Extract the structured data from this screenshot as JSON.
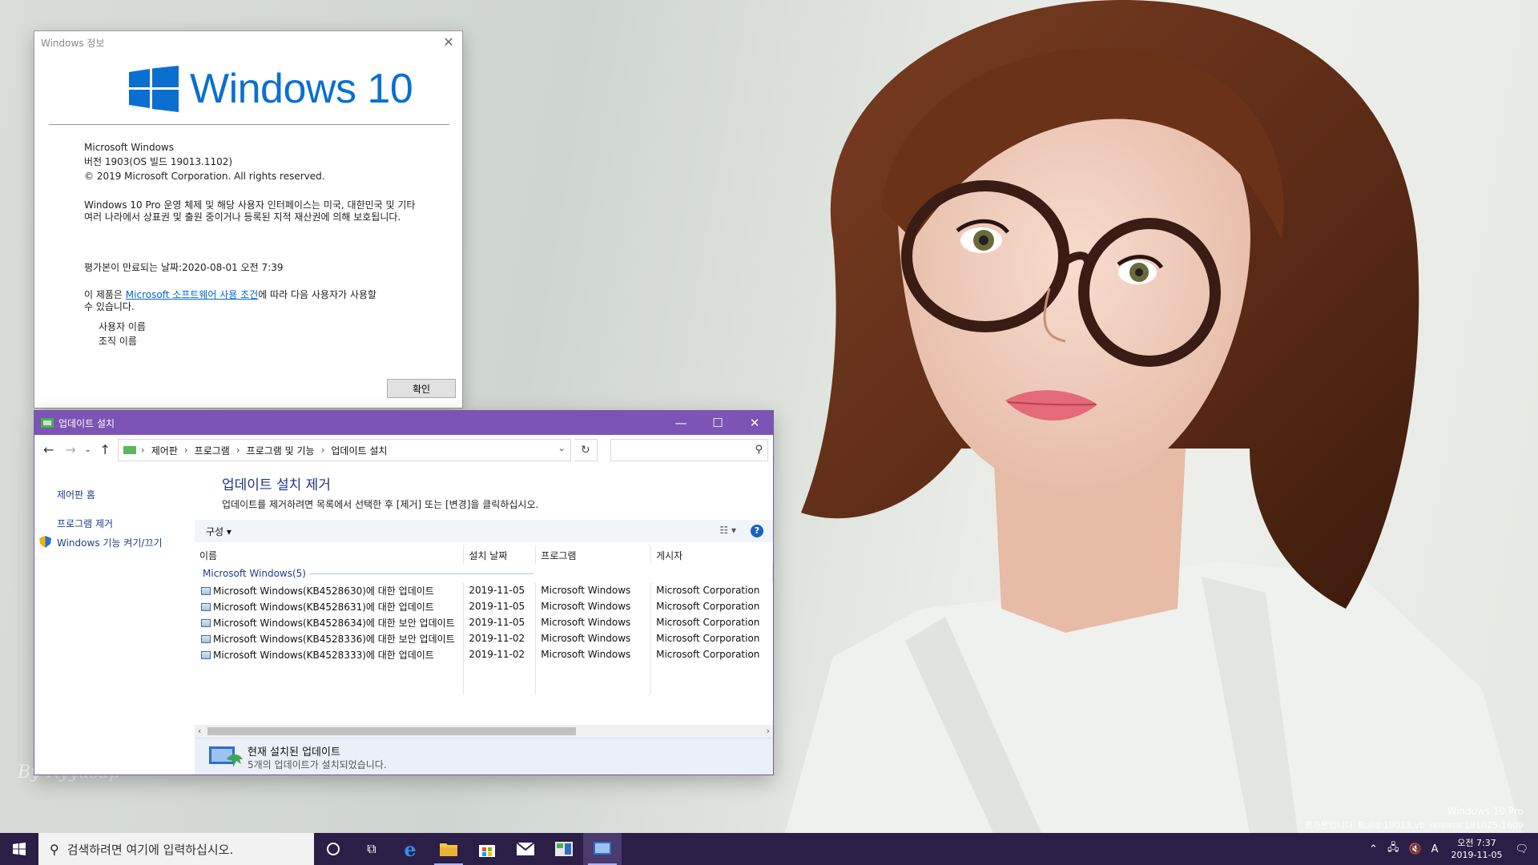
{
  "desktop": {
    "watermark_by": "By Ryyasap",
    "watermark_edition": "Windows 10 Pro",
    "watermark_build": "평가본입니다. Build 19013.vb_release.191025-1609"
  },
  "about": {
    "title": "Windows 정보",
    "logo_text": "Windows 10",
    "line1": "Microsoft Windows",
    "line2": "버전 1903(OS 빌드 19013.1102)",
    "line3": "© 2019 Microsoft Corporation. All rights reserved.",
    "para1": "Windows 10 Pro 운영 체제 및 해당 사용자 인터페이스는 미국, 대한민국 및 기타 여러 나라에서 상표권 및 출원 중이거나 등록된 지적 재산권에 의해 보호됩니다.",
    "expiry": "평가본이 만료되는 날짜:2020-08-01 오전 7:39",
    "license_pre": "이 제품은 ",
    "license_link": "Microsoft 소프트웨어 사용 조건",
    "license_post": "에 따라 다음 사용자가 사용할 수 있습니다.",
    "user_name": "사용자 이름",
    "org_name": "조직 이름",
    "ok": "확인"
  },
  "cp": {
    "title": "업데이트 설치",
    "breadcrumb": [
      "제어판",
      "프로그램",
      "프로그램 및 기능",
      "업데이트 설치"
    ],
    "search_placeholder": "",
    "left_home": "제어판 홈",
    "left_uninstall": "프로그램 제거",
    "left_features": "Windows 기능 켜기/끄기",
    "heading": "업데이트 설치 제거",
    "description": "업데이트를 제거하려면 목록에서 선택한 후 [제거] 또는 [변경]을 클릭하십시오.",
    "organize": "구성 ▾",
    "columns": [
      "이름",
      "설치 날짜",
      "프로그램",
      "게시자"
    ],
    "group": "Microsoft Windows(5)",
    "rows": [
      {
        "name": "Microsoft Windows(KB4528630)에 대한 업데이트",
        "date": "2019-11-05",
        "program": "Microsoft Windows",
        "publisher": "Microsoft Corporation"
      },
      {
        "name": "Microsoft Windows(KB4528631)에 대한 업데이트",
        "date": "2019-11-05",
        "program": "Microsoft Windows",
        "publisher": "Microsoft Corporation"
      },
      {
        "name": "Microsoft Windows(KB4528634)에 대한 보안 업데이트",
        "date": "2019-11-05",
        "program": "Microsoft Windows",
        "publisher": "Microsoft Corporation"
      },
      {
        "name": "Microsoft Windows(KB4528336)에 대한 보안 업데이트",
        "date": "2019-11-02",
        "program": "Microsoft Windows",
        "publisher": "Microsoft Corporation"
      },
      {
        "name": "Microsoft Windows(KB4528333)에 대한 업데이트",
        "date": "2019-11-02",
        "program": "Microsoft Windows",
        "publisher": "Microsoft Corporation"
      }
    ],
    "details_title": "현재 설치된 업데이트",
    "details_sub": "5개의 업데이트가 설치되었습니다."
  },
  "taskbar": {
    "search_placeholder": "검색하려면 여기에 입력하십시오.",
    "ime": "A",
    "time": "오전 7:37",
    "date": "2019-11-05"
  },
  "colors": {
    "cp_titlebar": "#7b54b5",
    "taskbar": "#2b1e47",
    "link": "#0066cc",
    "windows_blue": "#0a6fd1"
  }
}
